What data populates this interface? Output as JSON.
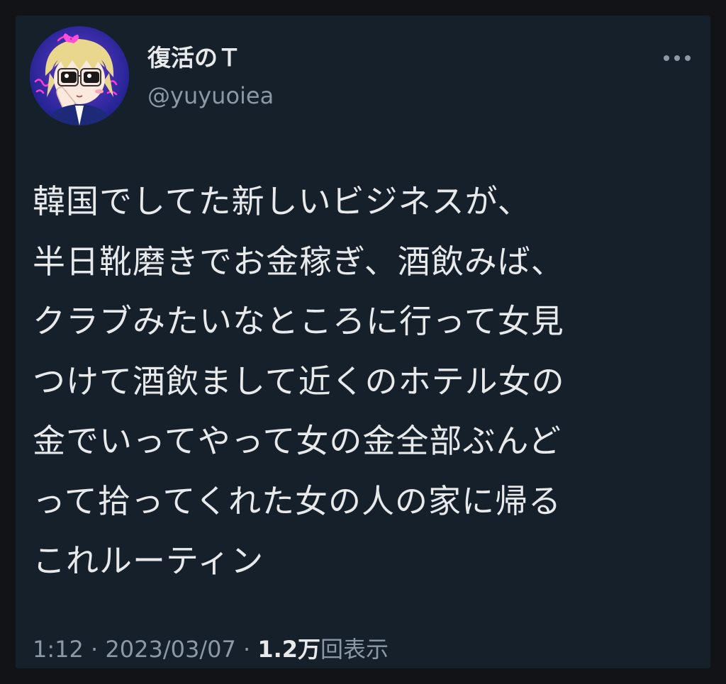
{
  "tweet": {
    "author": {
      "display_name": "復活のＴ",
      "handle": "@yuyuoiea",
      "avatar_icon": "anime-character-avatar"
    },
    "more_icon": "ellipsis-icon",
    "text_lines": [
      "韓国でしてた新しいビジネスが、",
      "半日靴磨きでお金稼ぎ、酒飲みば、",
      "クラブみたいなところに行って女見",
      "つけて酒飲まして近くのホテル女の",
      "金でいってやって女の金全部ぶんど",
      "って拾ってくれた女の人の家に帰る",
      "これルーティン"
    ],
    "meta": {
      "time": "1:12",
      "separator": " · ",
      "date": "2023/03/07",
      "views_count": "1.2万",
      "views_label": "回表示"
    }
  },
  "colors": {
    "card_background": "#15202b",
    "primary_text": "#e7e9ea",
    "secondary_text": "#8b98a5"
  }
}
